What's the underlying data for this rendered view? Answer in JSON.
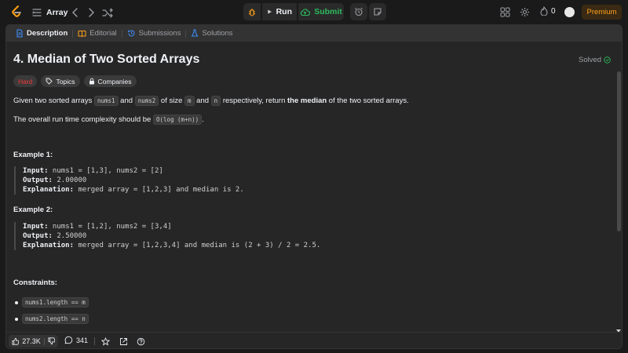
{
  "nav": {
    "list_label": "Array",
    "run_label": "Run",
    "submit_label": "Submit",
    "streak_count": "0",
    "premium_label": "Premium"
  },
  "tabs": [
    {
      "label": "Description"
    },
    {
      "label": "Editorial"
    },
    {
      "label": "Submissions"
    },
    {
      "label": "Solutions"
    }
  ],
  "problem": {
    "title": "4. Median of Two Sorted Arrays",
    "status": "Solved",
    "difficulty": "Hard",
    "topics_label": "Topics",
    "companies_label": "Companies",
    "desc_parts": {
      "p1": "Given two sorted arrays ",
      "c1": "nums1",
      "p2": " and ",
      "c2": "nums2",
      "p3": " of size ",
      "c3": "m",
      "p4": " and ",
      "c4": "n",
      "p5": " respectively, return ",
      "b1": "the median",
      "p6": " of the two sorted arrays."
    },
    "complexity_text": "The overall run time complexity should be ",
    "complexity_code": "O(log (m+n))",
    "complexity_end": ".",
    "examples": [
      {
        "heading": "Example 1:",
        "input_label": "Input:",
        "input": " nums1 = [1,3], nums2 = [2]",
        "output_label": "Output:",
        "output": " 2.00000",
        "explanation_label": "Explanation:",
        "explanation": " merged array = [1,2,3] and median is 2."
      },
      {
        "heading": "Example 2:",
        "input_label": "Input:",
        "input": " nums1 = [1,2], nums2 = [3,4]",
        "output_label": "Output:",
        "output": " 2.50000",
        "explanation_label": "Explanation:",
        "explanation": " merged array = [1,2,3,4] and median is (2 + 3) / 2 = 2.5."
      }
    ],
    "constraints_heading": "Constraints:",
    "constraints": [
      "nums1.length == m",
      "nums2.length == n"
    ]
  },
  "footer": {
    "likes": "27.3K",
    "comments": "341"
  },
  "colors": {
    "accent": "#ffa116",
    "success": "#2cbb5d",
    "hard": "#f63737"
  }
}
